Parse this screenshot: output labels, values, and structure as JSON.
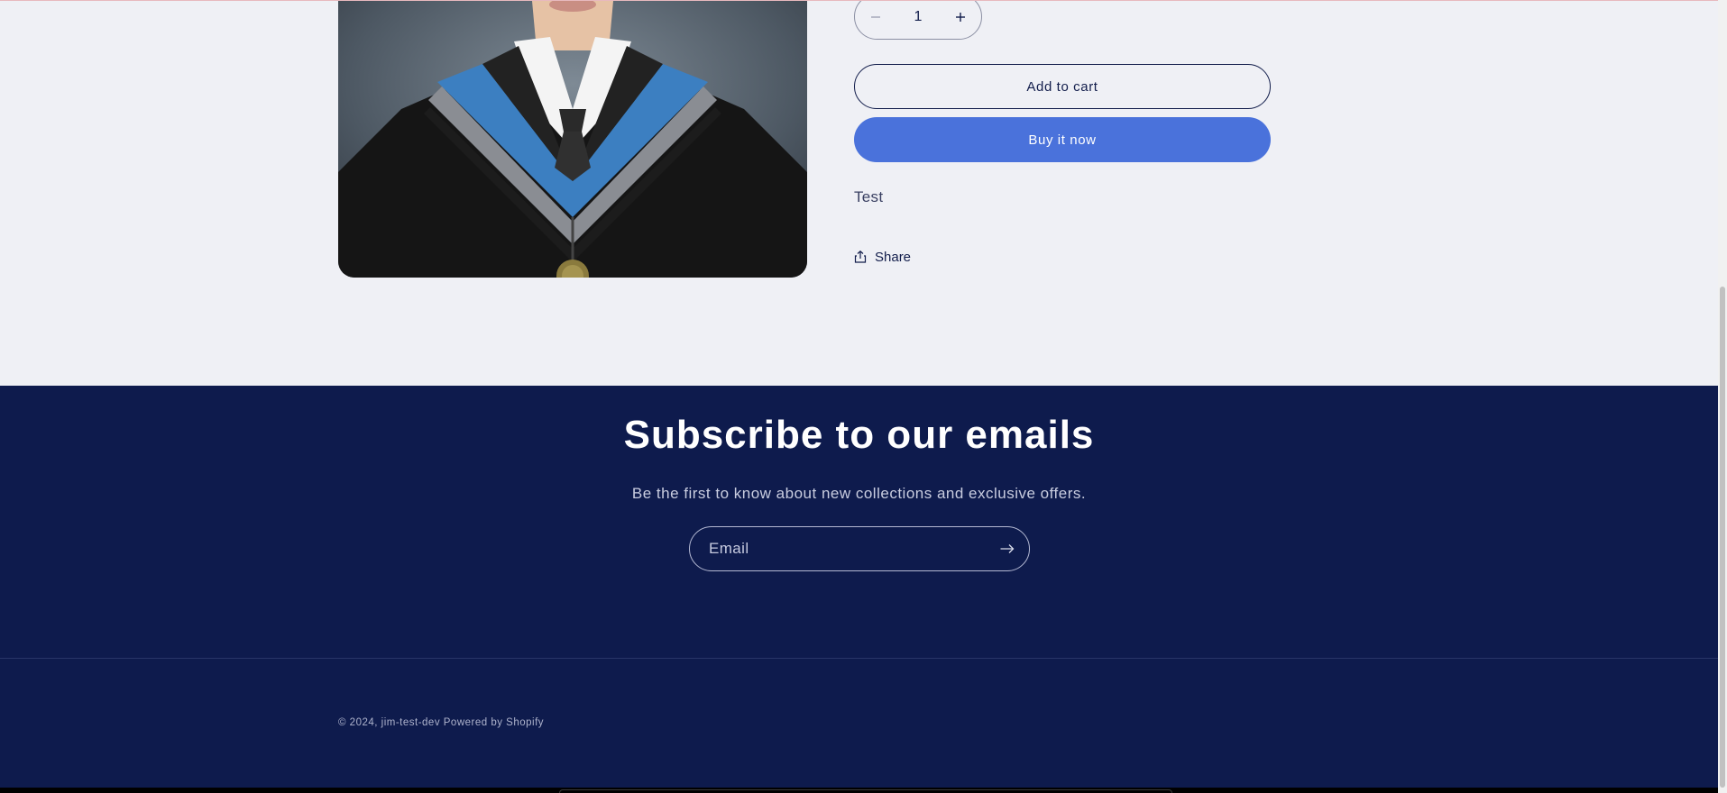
{
  "product": {
    "quantity": "1",
    "add_to_cart_label": "Add to cart",
    "buy_now_label": "Buy it now",
    "description": "Test",
    "share_label": "Share"
  },
  "newsletter": {
    "title": "Subscribe to our emails",
    "subtitle": "Be the first to know about new collections and exclusive offers.",
    "email_placeholder": "Email"
  },
  "footer": {
    "copyright": "© 2024, jim-test-dev Powered by Shopify"
  },
  "colors": {
    "page_background": "#eff0f5",
    "footer_background": "#0e1b4d",
    "accent_button": "#4a72db",
    "text_dark": "#121d4b"
  },
  "icons": {
    "minus": "minus-icon",
    "plus": "plus-icon",
    "share": "share-icon",
    "arrow": "arrow-right-icon"
  }
}
